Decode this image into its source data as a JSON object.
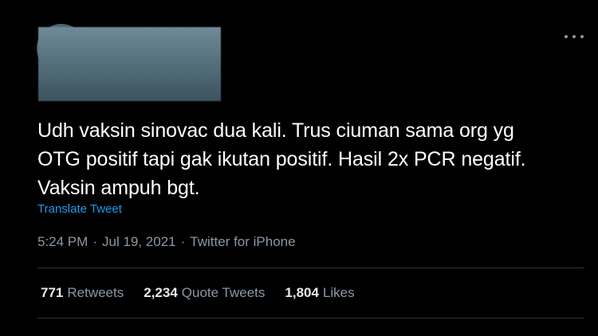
{
  "tweet": {
    "text_lines": [
      "Udh vaksin sinovac dua kali. Trus ciuman sama org yg",
      "OTG positif tapi gak ikutan positif. Hasil 2x PCR negatif.",
      "Vaksin ampuh bgt."
    ],
    "translate_label": "Translate Tweet",
    "time": "5:24 PM",
    "date": "Jul 19, 2021",
    "source": "Twitter for iPhone",
    "meta_separator": "·"
  },
  "stats": {
    "retweets": {
      "count": "771",
      "label": "Retweets"
    },
    "quotes": {
      "count": "2,234",
      "label": "Quote Tweets"
    },
    "likes": {
      "count": "1,804",
      "label": "Likes"
    }
  },
  "icons": {
    "more": "more-options-icon"
  },
  "colors": {
    "background": "#000000",
    "text": "#ffffff",
    "secondary": "#8b98a5",
    "link": "#1d9bf0",
    "divider": "#2f3336"
  }
}
